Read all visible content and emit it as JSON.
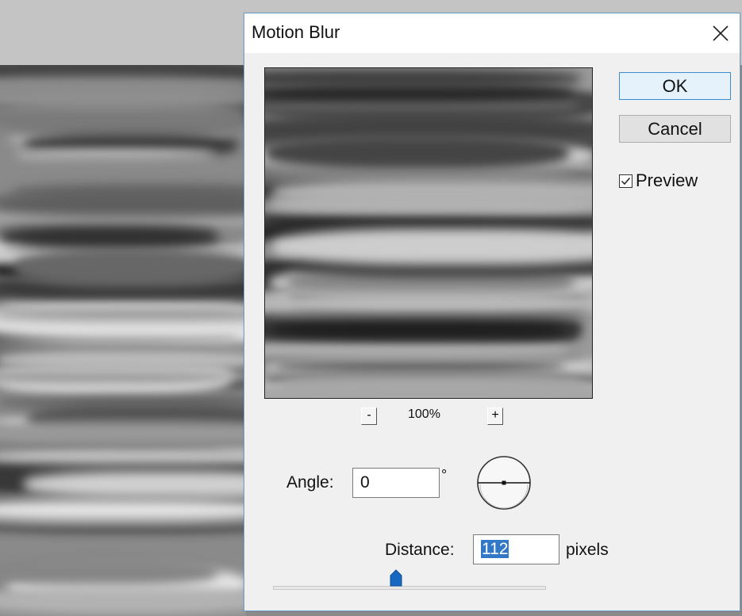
{
  "dialog": {
    "title": "Motion Blur",
    "close_icon": "close-icon"
  },
  "preview": {
    "zoom_out_label": "-",
    "zoom_in_label": "+",
    "zoom_level": "100%"
  },
  "buttons": {
    "ok_label": "OK",
    "cancel_label": "Cancel"
  },
  "preview_toggle": {
    "label": "Preview",
    "checked": true
  },
  "angle": {
    "label": "Angle:",
    "value": "0",
    "unit": "°"
  },
  "distance": {
    "label": "Distance:",
    "value": "112",
    "unit": "pixels",
    "slider_fraction": 0.45
  },
  "colors": {
    "ok_border": "#3c8dcf",
    "ok_fill": "#e5f1fb",
    "selection": "#3178c6"
  }
}
